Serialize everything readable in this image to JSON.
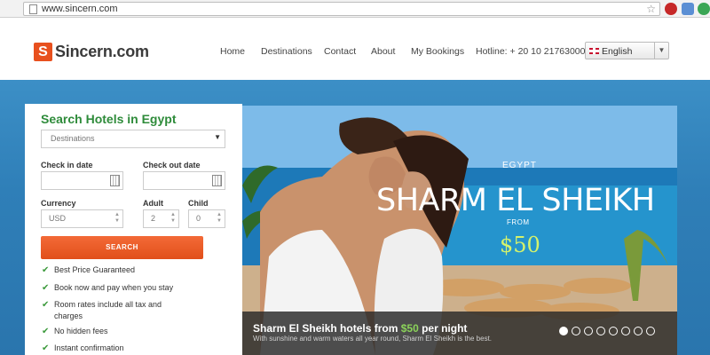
{
  "browser": {
    "url": "www.sincern.com"
  },
  "header": {
    "logo_mark": "S",
    "logo_text": "Sincern.com",
    "nav": {
      "home": "Home",
      "destinations": "Destinations",
      "contact": "Contact",
      "about": "About",
      "bookings": "My Bookings"
    },
    "hotline": "Hotline: + 20 10 21763000",
    "language": "English"
  },
  "search": {
    "title": "Search Hotels in Egypt",
    "destination_placeholder": "Destinations",
    "checkin_label": "Check in date",
    "checkout_label": "Check out date",
    "currency_label": "Currency",
    "currency_value": "USD",
    "adult_label": "Adult",
    "adult_value": "2",
    "child_label": "Child",
    "child_value": "0",
    "button": "SEARCH",
    "features": [
      "Best Price Guaranteed",
      "Book now and pay when you stay",
      "Room rates include all tax and charges",
      "No hidden fees",
      "Instant confirmation"
    ]
  },
  "slide": {
    "country": "EGYPT",
    "city": "SHARM EL SHEIKH",
    "from": "FROM",
    "price": "$50",
    "caption_pre": "Sharm El Sheikh hotels from ",
    "caption_price": "$50",
    "caption_post": " per night",
    "caption_sub": "With sunshine and warm waters all year round, Sharm El Sheikh is the best.",
    "dot_count": 8,
    "active_dot": 1
  }
}
